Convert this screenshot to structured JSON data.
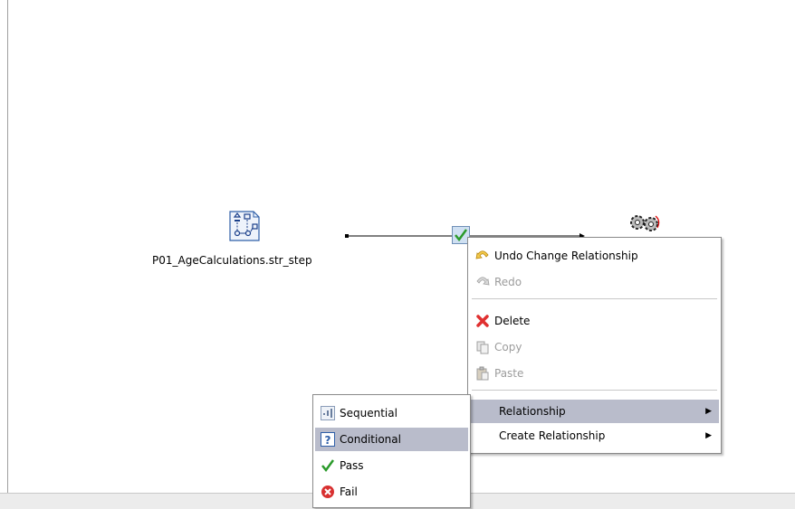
{
  "diagram": {
    "source_node_label": "P01_AgeCalculations.str_step"
  },
  "context_menu": {
    "items": [
      {
        "label": "Undo Change Relationship",
        "icon": "undo-icon",
        "enabled": true
      },
      {
        "label": "Redo",
        "icon": "redo-icon",
        "enabled": false
      },
      {
        "label": "Delete",
        "icon": "delete-icon",
        "enabled": true
      },
      {
        "label": "Copy",
        "icon": "copy-icon",
        "enabled": false
      },
      {
        "label": "Paste",
        "icon": "paste-icon",
        "enabled": false
      },
      {
        "label": "Relationship",
        "icon": "",
        "enabled": true,
        "submenu": true,
        "highlighted": true
      },
      {
        "label": "Create Relationship",
        "icon": "",
        "enabled": true,
        "submenu": true
      }
    ]
  },
  "relationship_submenu": {
    "items": [
      {
        "label": "Sequential",
        "icon": "sequential-icon"
      },
      {
        "label": "Conditional",
        "icon": "conditional-icon",
        "highlighted": true
      },
      {
        "label": "Pass",
        "icon": "pass-icon"
      },
      {
        "label": "Fail",
        "icon": "fail-icon"
      }
    ]
  },
  "colors": {
    "highlight": "#b9bccb",
    "disabled_text": "#9c9c9c"
  }
}
